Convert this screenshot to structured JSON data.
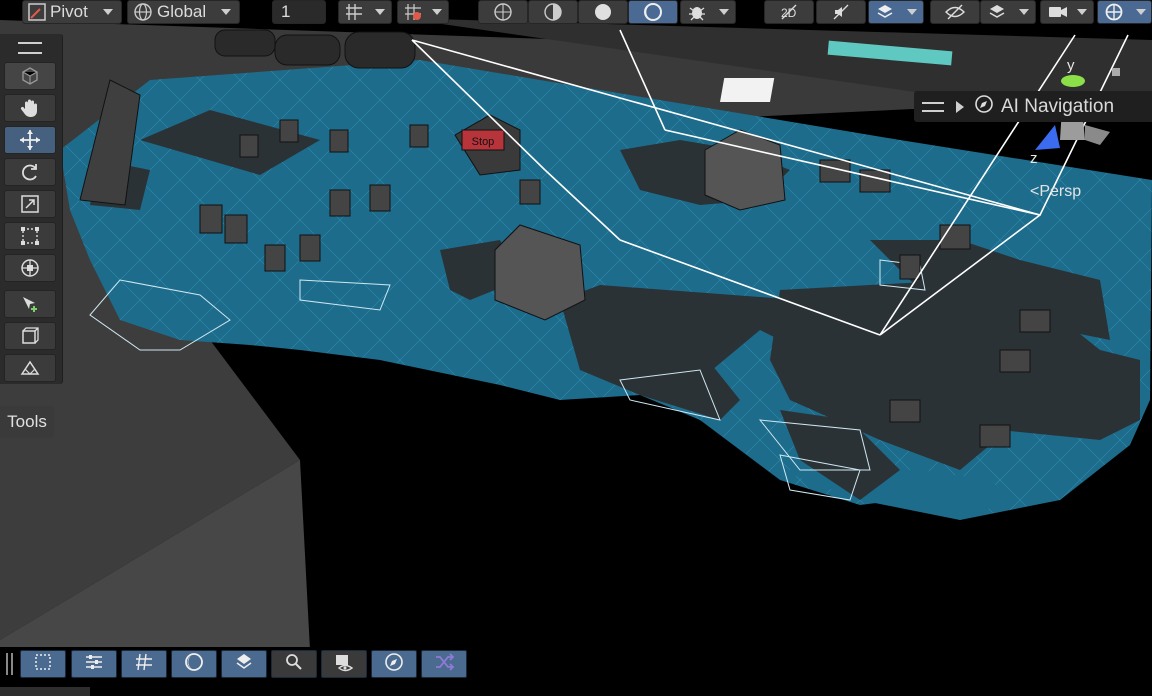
{
  "toolbar": {
    "pivot_label": "Pivot",
    "global_label": "Global",
    "grid_snap_value": "1",
    "icons": [
      "pivot-icon",
      "globe-icon",
      "grid-snap-icon",
      "snap-magnet-icon",
      "wireframe-icon",
      "shaded-wireframe-icon",
      "shaded-icon",
      "unlit-icon",
      "bug-icon",
      "2d-icon",
      "audio-icon",
      "effects-icon",
      "hidden-icon",
      "layers-icon",
      "camera-icon",
      "gizmos-icon"
    ]
  },
  "tools": {
    "items": [
      "view-tool",
      "hand-tool",
      "move-tool",
      "rotate-tool",
      "scale-tool",
      "rect-tool",
      "transform-tool",
      "custom-tool",
      "create-tool",
      "navmesh-tool"
    ],
    "active": "move-tool",
    "tab_label": "Tools"
  },
  "overlay": {
    "ai_navigation_label": "AI Navigation",
    "persp_label": "Persp",
    "gizmo_axes": {
      "y": "y",
      "z": "z"
    },
    "sign_text": "Stop"
  },
  "bottom_toolbar": {
    "icons": [
      "select-icon",
      "settings-sliders-icon",
      "grid-hash-icon",
      "moon-icon",
      "layers-diamond-icon",
      "search-icon",
      "camera-eye-icon",
      "compass-icon",
      "shuffle-icon"
    ]
  },
  "colors": {
    "navmesh": "#1f6b8a",
    "navmesh_line": "#4fb6d8",
    "toolbar_bg": "#3c3c3c",
    "active_blue": "#4a6a94",
    "shuffle_purple": "#8f7bd6"
  }
}
